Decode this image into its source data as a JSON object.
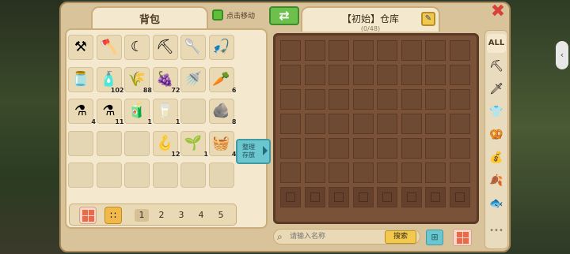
{
  "bag": {
    "title": "背包",
    "items": [
      {
        "icon": "pickaxe-icon",
        "glyph": "⚒",
        "count": ""
      },
      {
        "icon": "axe-icon",
        "glyph": "🪓",
        "count": ""
      },
      {
        "icon": "sickle-icon",
        "glyph": "☾",
        "count": ""
      },
      {
        "icon": "hoe-icon",
        "glyph": "⛏",
        "count": ""
      },
      {
        "icon": "shovel-icon",
        "glyph": "🥄",
        "count": ""
      },
      {
        "icon": "fishing-rod-icon",
        "glyph": "🎣",
        "count": ""
      },
      {
        "icon": "jar-icon",
        "glyph": "🫙",
        "count": ""
      },
      {
        "icon": "bottle-icon",
        "glyph": "🧴",
        "count": "102"
      },
      {
        "icon": "wheat-icon",
        "glyph": "🌾",
        "count": "88"
      },
      {
        "icon": "berry-icon",
        "glyph": "🍇",
        "count": "72"
      },
      {
        "icon": "watering-can-icon",
        "glyph": "🚿",
        "count": ""
      },
      {
        "icon": "carrot-icon",
        "glyph": "🥕",
        "count": "6"
      },
      {
        "icon": "red-potion-icon",
        "glyph": "⚗",
        "count": "4"
      },
      {
        "icon": "blue-potion-icon",
        "glyph": "⚗",
        "count": "11"
      },
      {
        "icon": "juice-bottle-icon",
        "glyph": "🧃",
        "count": "1"
      },
      {
        "icon": "milk-jar-icon",
        "glyph": "🥛",
        "count": "1"
      },
      {
        "icon": "empty",
        "glyph": "",
        "count": ""
      },
      {
        "icon": "stones-icon",
        "glyph": "🪨",
        "count": "8"
      },
      {
        "icon": "empty",
        "glyph": "",
        "count": ""
      },
      {
        "icon": "empty",
        "glyph": "",
        "count": ""
      },
      {
        "icon": "empty",
        "glyph": "",
        "count": ""
      },
      {
        "icon": "hook-icon",
        "glyph": "🪝",
        "count": "12"
      },
      {
        "icon": "seed-packet-icon",
        "glyph": "🌱",
        "count": "1"
      },
      {
        "icon": "basket-icon",
        "glyph": "🧺",
        "count": "4"
      },
      {
        "icon": "empty",
        "glyph": "",
        "count": ""
      },
      {
        "icon": "empty",
        "glyph": "",
        "count": ""
      },
      {
        "icon": "empty",
        "glyph": "",
        "count": ""
      },
      {
        "icon": "empty",
        "glyph": "",
        "count": ""
      },
      {
        "icon": "empty",
        "glyph": "",
        "count": ""
      },
      {
        "icon": "empty",
        "glyph": "",
        "count": ""
      }
    ],
    "sort_label_1": "整理",
    "sort_label_2": "存放",
    "pages": [
      "1",
      "2",
      "3",
      "4",
      "5"
    ],
    "active_page": "1"
  },
  "toolbar": {
    "move_label": "点击移动",
    "swap_glyph": "⇄"
  },
  "storage": {
    "title": "【初始】仓库",
    "count": "(0/48)",
    "search_placeholder": "请输入名称",
    "search_button": "搜索",
    "categories": [
      {
        "name": "all",
        "label": "ALL",
        "glyph": ""
      },
      {
        "name": "tools",
        "label": "",
        "glyph": "⛏"
      },
      {
        "name": "weapons",
        "label": "",
        "glyph": "🗡"
      },
      {
        "name": "clothing",
        "label": "",
        "glyph": "👕"
      },
      {
        "name": "food",
        "label": "",
        "glyph": "🥨"
      },
      {
        "name": "bags",
        "label": "",
        "glyph": "💰"
      },
      {
        "name": "leaves",
        "label": "",
        "glyph": "🍂"
      },
      {
        "name": "fish",
        "label": "",
        "glyph": "🐟"
      }
    ],
    "more_glyph": "•••",
    "close_glyph": "✖",
    "edit_glyph": "✎"
  },
  "colors": {
    "panel": "#f4e9cf",
    "frame": "#d9c39a",
    "storage_bg": "#7a5238",
    "accent_green": "#6dc04b",
    "accent_teal": "#6cc6cf",
    "accent_yellow": "#f2c94c",
    "close_red": "#d9423a"
  }
}
